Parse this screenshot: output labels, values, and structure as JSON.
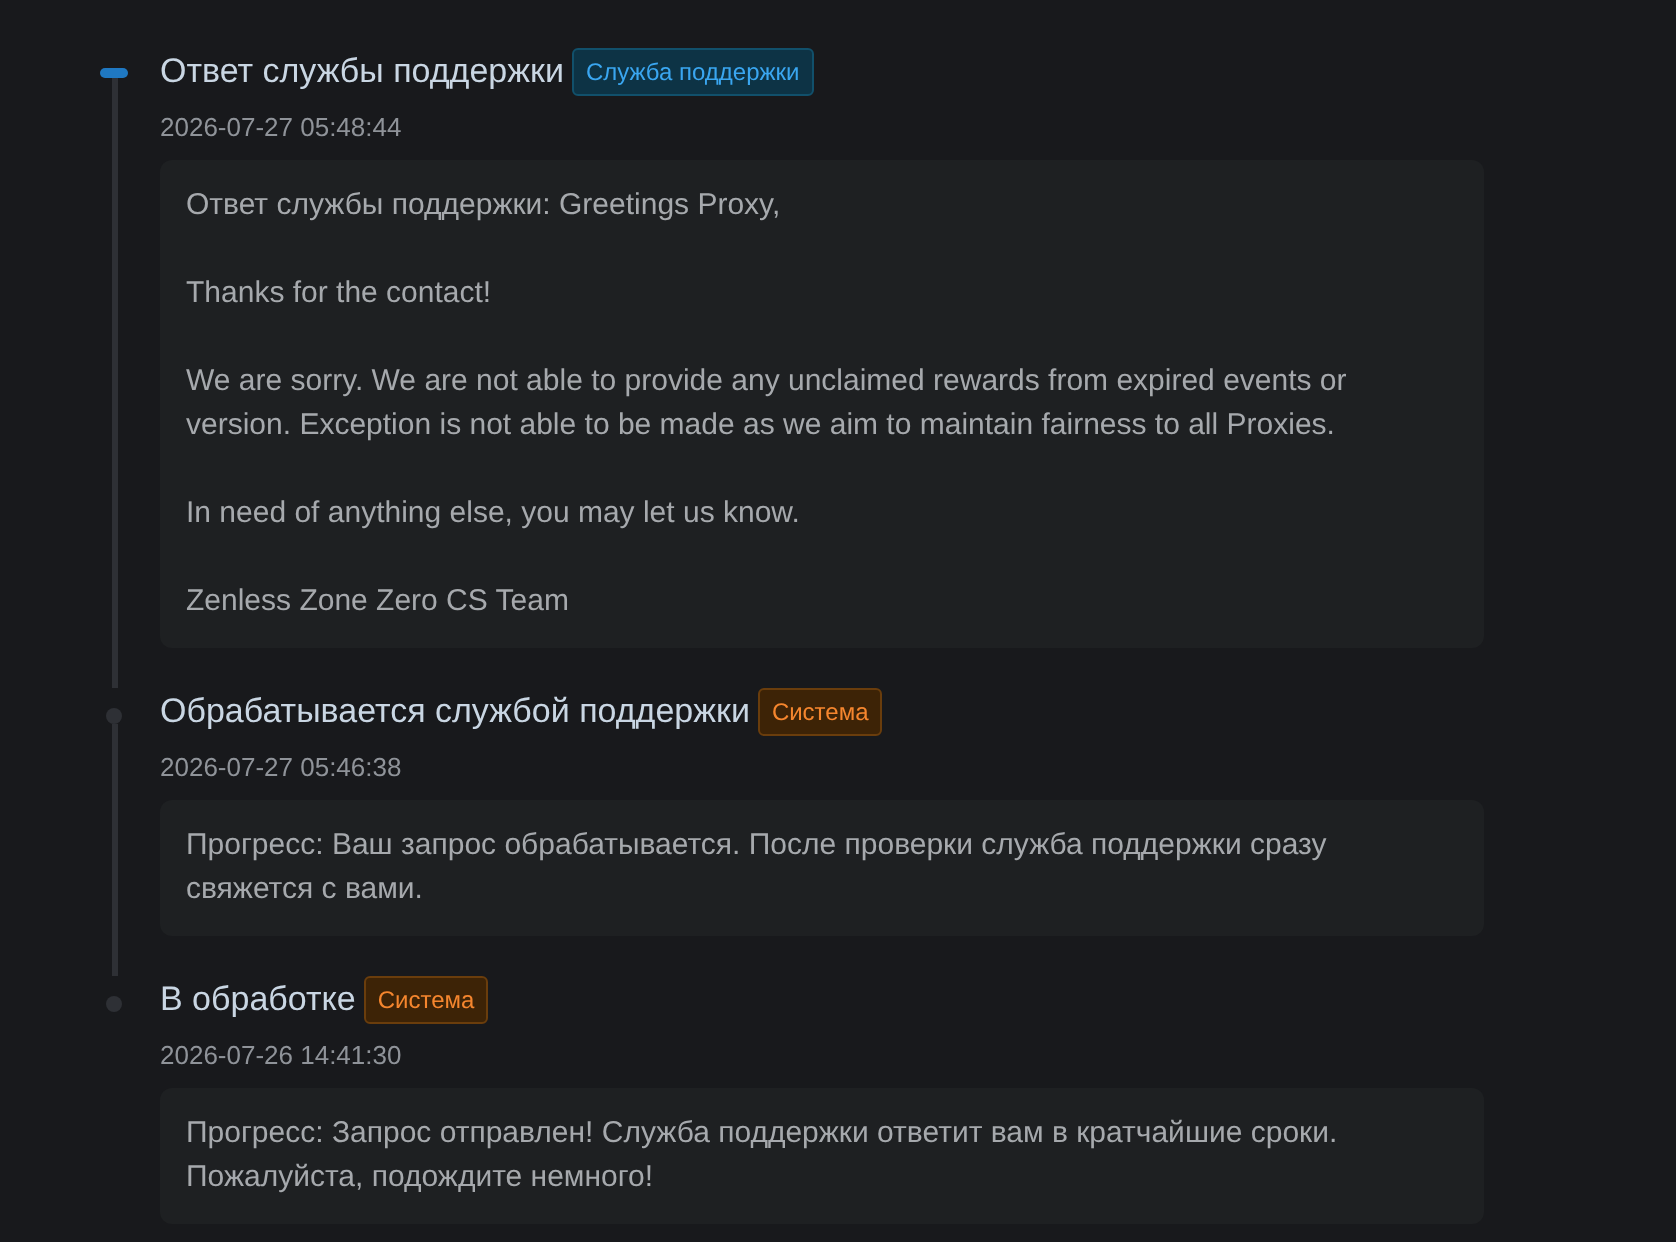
{
  "timeline": [
    {
      "title": "Ответ службы поддержки",
      "tag": {
        "label": "Служба поддержки",
        "kind": "support"
      },
      "time": "2026-07-27 05:48:44",
      "active": true,
      "paragraphs": [
        "Ответ службы поддержки: Greetings Proxy,",
        "Thanks for the contact!",
        "We are sorry. We are not able to provide any unclaimed rewards from expired events or version. Exception is not able to be made as we aim to maintain fairness to all Proxies.",
        "In need of anything else, you may let us know.",
        "Zenless Zone Zero CS Team"
      ]
    },
    {
      "title": "Обрабатывается службой поддержки",
      "tag": {
        "label": "Система",
        "kind": "system"
      },
      "time": "2026-07-27 05:46:38",
      "active": false,
      "paragraphs": [
        "Прогресс: Ваш запрос обрабатывается. После проверки служба поддержки сразу свяжется с вами."
      ]
    },
    {
      "title": "В обработке",
      "tag": {
        "label": "Система",
        "kind": "system"
      },
      "time": "2026-07-26 14:41:30",
      "active": false,
      "paragraphs": [
        "Прогресс: Запрос отправлен! Служба поддержки ответит вам в кратчайшие сроки. Пожалуйста, подождите немного!"
      ]
    }
  ]
}
